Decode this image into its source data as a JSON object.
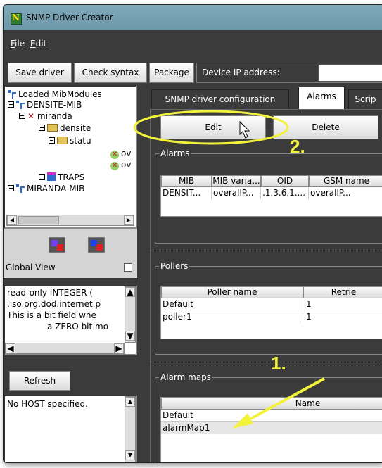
{
  "window": {
    "title": "SNMP Driver Creator"
  },
  "menubar": {
    "items": [
      {
        "label": "File",
        "mnemonic": "F"
      },
      {
        "label": "Edit",
        "mnemonic": "E"
      }
    ]
  },
  "toolbar": {
    "save_label": "Save driver",
    "check_label": "Check syntax",
    "package_label": "Package",
    "device_ip_label": "Device IP address:",
    "device_ip_value": ""
  },
  "tree": {
    "root": "Loaded MibModules",
    "items": [
      {
        "label": "DENSITE-MIB",
        "level": 1
      },
      {
        "label": "miranda",
        "level": 2
      },
      {
        "label": "densite",
        "level": 3
      },
      {
        "label": "statu",
        "level": 4
      },
      {
        "label": "ov",
        "level": 5
      },
      {
        "label": "ov",
        "level": 5
      },
      {
        "label": "TRAPS",
        "level": 2
      },
      {
        "label": "MIRANDA-MIB",
        "level": 1
      }
    ]
  },
  "global_view": {
    "label": "Global View",
    "checked": false
  },
  "description": {
    "lines": [
      "read-only INTEGER (",
      ".iso.org.dod.internet.p",
      "This is a bit field whe",
      "a ZERO bit mo"
    ]
  },
  "refresh": {
    "label": "Refresh"
  },
  "host": {
    "text": "No HOST specified."
  },
  "tabs": [
    {
      "label": "SNMP driver configuration",
      "active": false
    },
    {
      "label": "Alarms",
      "active": true
    },
    {
      "label": "Scrip",
      "active": false
    }
  ],
  "alarm_buttons": {
    "edit": "Edit",
    "delete": "Delete"
  },
  "alarms": {
    "group_label": "Alarms",
    "columns": [
      "MIB",
      "MIB varia...",
      "OID",
      "GSM name"
    ],
    "rows": [
      [
        "DENSIT...",
        "overallP...",
        ".1.3.6.1....",
        "overallP..."
      ]
    ]
  },
  "pollers": {
    "group_label": "Pollers",
    "columns": [
      "Poller name",
      "Retrie"
    ],
    "rows": [
      [
        "Default",
        "1"
      ],
      [
        "poller1",
        "1"
      ]
    ]
  },
  "alarm_maps": {
    "group_label": "Alarm maps",
    "columns": [
      "Name"
    ],
    "rows": [
      "Default",
      "alarmMap1"
    ]
  },
  "callouts": {
    "step1": "1.",
    "step2": "2."
  },
  "colors": {
    "callout": "#f3f23a",
    "window_bg": "#3b3b3b",
    "titlebar": "#7fa9b9"
  }
}
